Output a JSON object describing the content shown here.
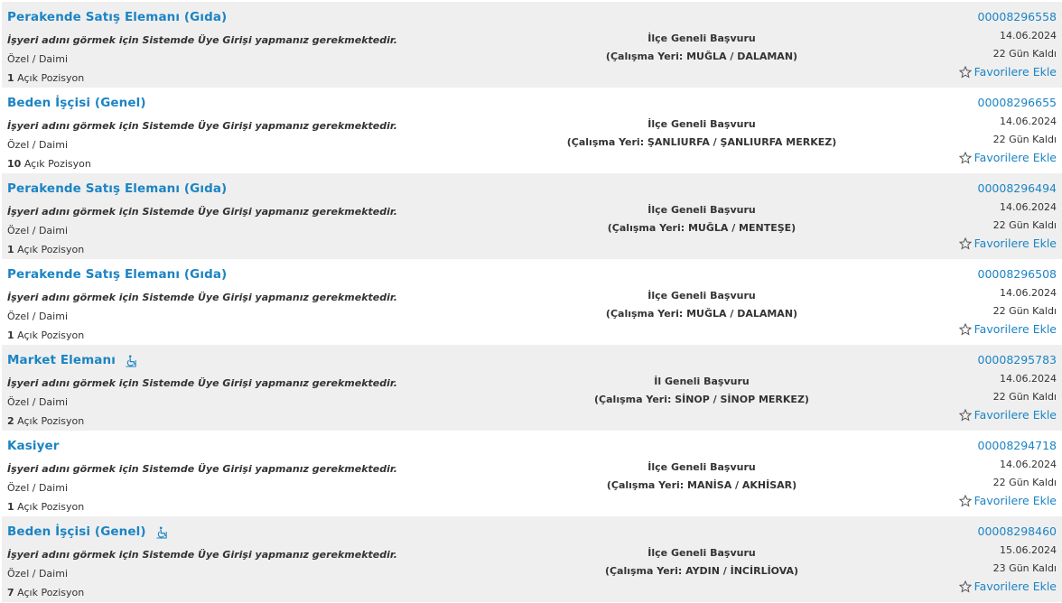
{
  "common": {
    "notice": "İşyeri adını görmek için Sistemde Üye Girişi yapmanız gerekmektedir.",
    "positions_suffix": "Açık Pozisyon",
    "favorite_label": "Favorilere Ekle"
  },
  "jobs": [
    {
      "title": "Perakende Satış Elemanı (Gıda)",
      "disabled_friendly": false,
      "type": "Özel / Daimi",
      "positions": "1",
      "scope": "İlçe Geneli Başvuru",
      "location": "(Çalışma Yeri: MUĞLA / DALAMAN)",
      "job_no": "00008296558",
      "date": "14.06.2024",
      "remaining": "22 Gün Kaldı"
    },
    {
      "title": "Beden İşçisi (Genel)",
      "disabled_friendly": false,
      "type": "Özel / Daimi",
      "positions": "10",
      "scope": "İlçe Geneli Başvuru",
      "location": "(Çalışma Yeri: ŞANLIURFA / ŞANLIURFA MERKEZ)",
      "job_no": "00008296655",
      "date": "14.06.2024",
      "remaining": "22 Gün Kaldı"
    },
    {
      "title": "Perakende Satış Elemanı (Gıda)",
      "disabled_friendly": false,
      "type": "Özel / Daimi",
      "positions": "1",
      "scope": "İlçe Geneli Başvuru",
      "location": "(Çalışma Yeri: MUĞLA / MENTEŞE)",
      "job_no": "00008296494",
      "date": "14.06.2024",
      "remaining": "22 Gün Kaldı"
    },
    {
      "title": "Perakende Satış Elemanı (Gıda)",
      "disabled_friendly": false,
      "type": "Özel / Daimi",
      "positions": "1",
      "scope": "İlçe Geneli Başvuru",
      "location": "(Çalışma Yeri: MUĞLA / DALAMAN)",
      "job_no": "00008296508",
      "date": "14.06.2024",
      "remaining": "22 Gün Kaldı"
    },
    {
      "title": "Market Elemanı",
      "disabled_friendly": true,
      "type": "Özel / Daimi",
      "positions": "2",
      "scope": "İl Geneli Başvuru",
      "location": "(Çalışma Yeri: SİNOP / SİNOP MERKEZ)",
      "job_no": "00008295783",
      "date": "14.06.2024",
      "remaining": "22 Gün Kaldı"
    },
    {
      "title": "Kasiyer",
      "disabled_friendly": false,
      "type": "Özel / Daimi",
      "positions": "1",
      "scope": "İlçe Geneli Başvuru",
      "location": "(Çalışma Yeri: MANİSA / AKHİSAR)",
      "job_no": "00008294718",
      "date": "14.06.2024",
      "remaining": "22 Gün Kaldı"
    },
    {
      "title": "Beden İşçisi (Genel)",
      "disabled_friendly": true,
      "type": "Özel / Daimi",
      "positions": "7",
      "scope": "İlçe Geneli Başvuru",
      "location": "(Çalışma Yeri: AYDIN / İNCİRLİOVA)",
      "job_no": "00008298460",
      "date": "15.06.2024",
      "remaining": "23 Gün Kaldı"
    }
  ],
  "icons": {
    "disabled": "wheelchair-icon",
    "favorite": "star-outline-icon"
  },
  "colors": {
    "link": "#1b84c4",
    "row_alt": "#efefef"
  }
}
